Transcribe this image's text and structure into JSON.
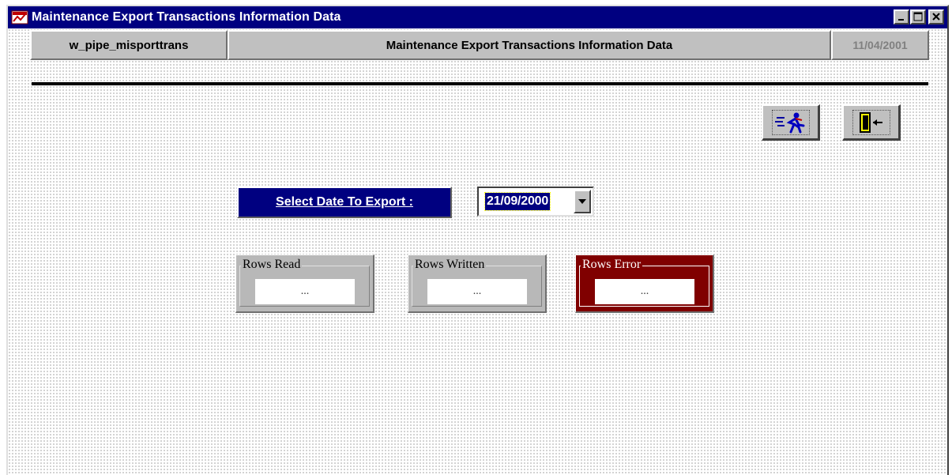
{
  "window": {
    "title": "Maintenance Export Transactions Information Data"
  },
  "header": {
    "object_name": "w_pipe_misporttrans",
    "form_title": "Maintenance Export Transactions Information Data",
    "date": "11/04/2001"
  },
  "toolbar": {
    "run_icon": "run-icon",
    "exit_icon": "exit-door-icon"
  },
  "export": {
    "label": "Select Date To Export :",
    "selected_date": "21/09/2000"
  },
  "stats": {
    "rows_read": {
      "label": "Rows Read",
      "value": "..."
    },
    "rows_written": {
      "label": "Rows Written",
      "value": "..."
    },
    "rows_error": {
      "label": "Rows Error",
      "value": "..."
    }
  },
  "colors": {
    "titlebar": "#000080",
    "error_group": "#800000",
    "face": "#c0c0c0"
  }
}
